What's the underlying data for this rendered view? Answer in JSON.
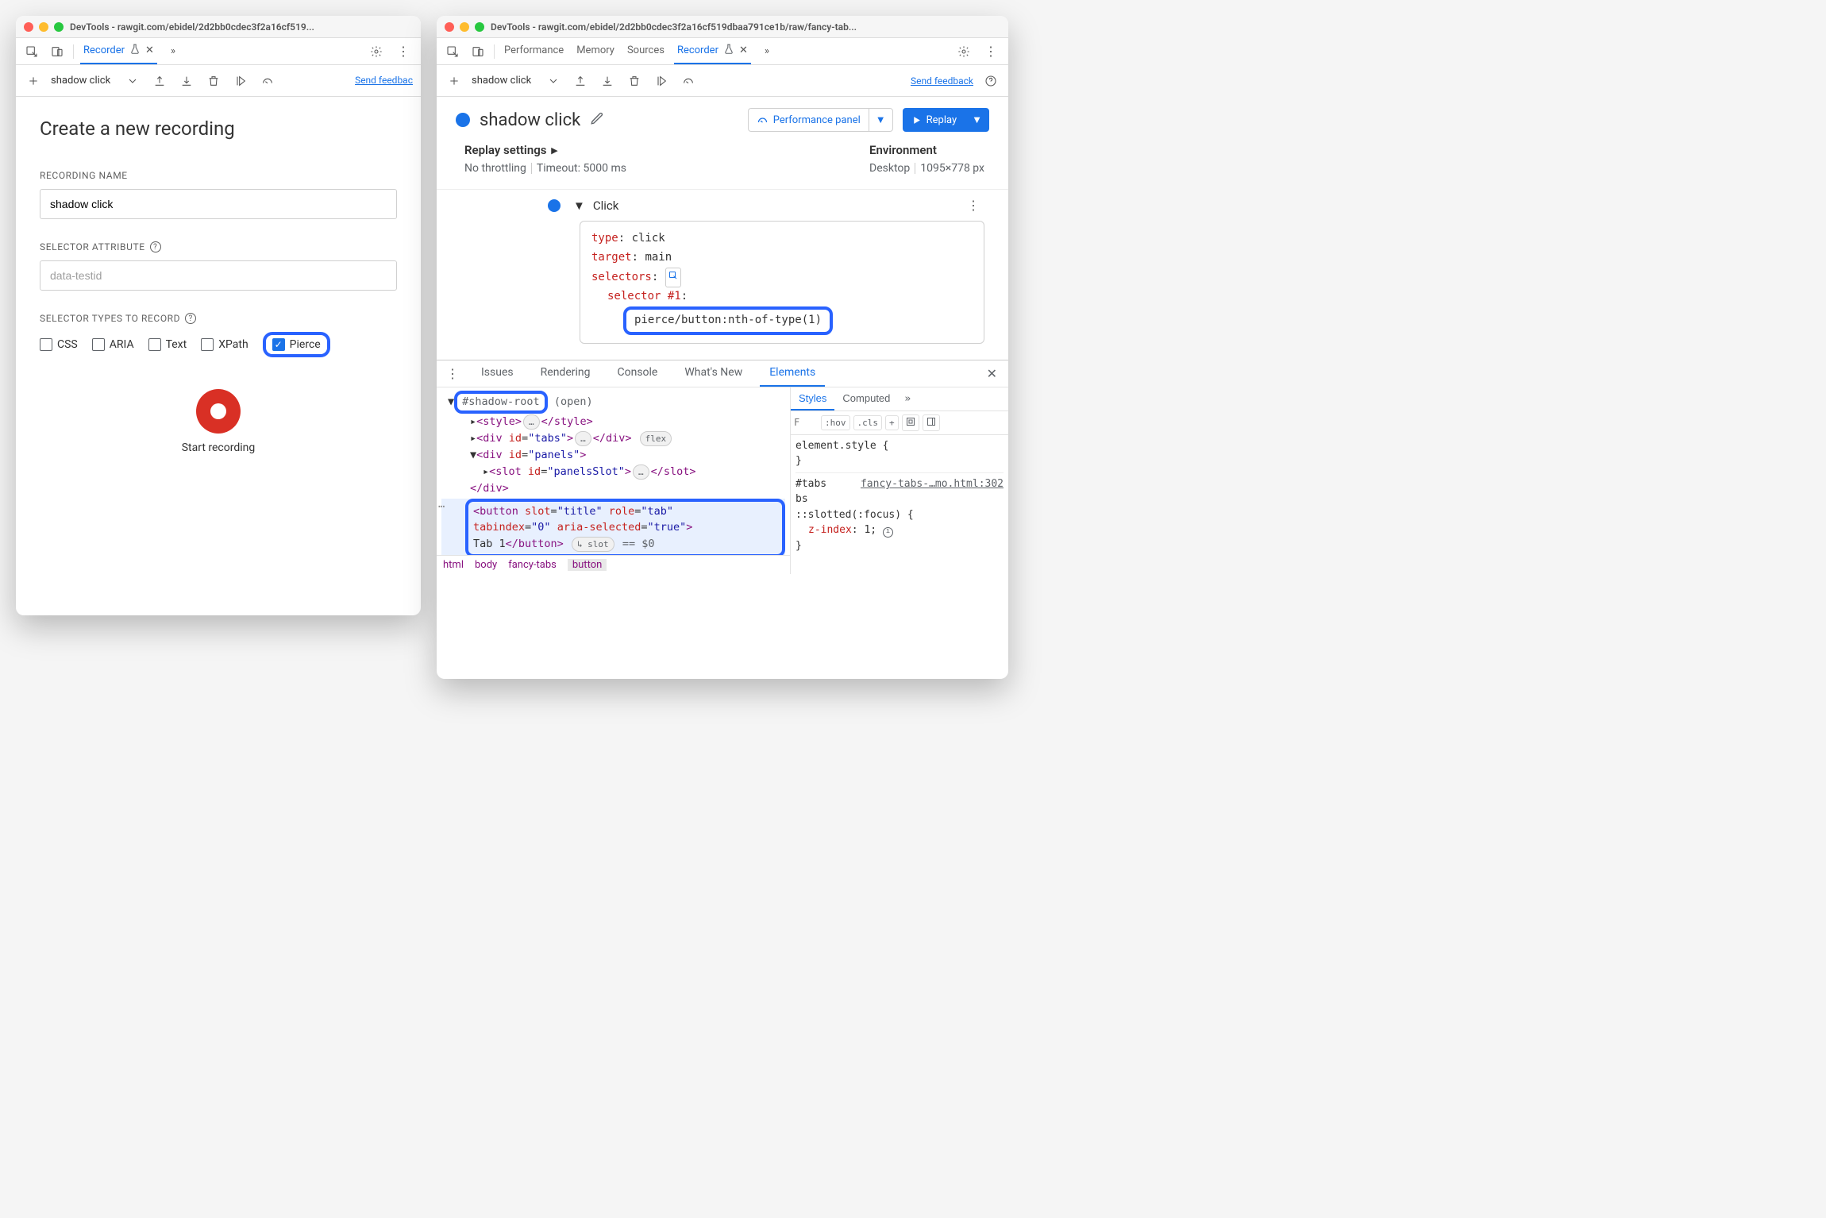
{
  "window_title": "DevTools - rawgit.com/ebidel/2d2bb0cdec3f2a16cf519...",
  "window_title2": "DevTools - rawgit.com/ebidel/2d2bb0cdec3f2a16cf519dbaa791ce1b/raw/fancy-tab...",
  "tabs": {
    "recorder": "Recorder",
    "performance": "Performance",
    "memory": "Memory",
    "sources": "Sources"
  },
  "subbar": {
    "name": "shadow click",
    "send_feedback": "Send feedback",
    "send_feedback_short": "Send feedbac"
  },
  "create": {
    "title": "Create a new recording",
    "name_label": "RECORDING NAME",
    "name_value": "shadow click",
    "selector_attr_label": "SELECTOR ATTRIBUTE",
    "selector_attr_placeholder": "data-testid",
    "selector_types_label": "SELECTOR TYPES TO RECORD",
    "types": {
      "css": "CSS",
      "aria": "ARIA",
      "text": "Text",
      "xpath": "XPath",
      "pierce": "Pierce"
    },
    "start_recording": "Start recording"
  },
  "flow": {
    "title": "shadow click",
    "perf_panel": "Performance panel",
    "replay": "Replay",
    "replay_settings": "Replay settings",
    "environment": "Environment",
    "throttling": "No throttling",
    "timeout": "Timeout: 5000 ms",
    "device": "Desktop",
    "viewport": "1095×778 px",
    "step_label": "Click",
    "step_type_key": "type",
    "step_type_val": "click",
    "step_target_key": "target",
    "step_target_val": "main",
    "step_selectors_key": "selectors",
    "step_sel1_key": "selector #1",
    "step_sel1_val": "pierce/button:nth-of-type(1)"
  },
  "drawer": {
    "issues": "Issues",
    "rendering": "Rendering",
    "console": "Console",
    "whatsnew": "What's New",
    "elements": "Elements",
    "tree": {
      "shadow_root": "#shadow-root",
      "open": "(open)",
      "style_open": "<style>",
      "style_close": "</style>",
      "div_tabs_open": "<div id=\"tabs\">",
      "div_tabs_close": "</div>",
      "flex_badge": "flex",
      "div_panels_open": "<div id=\"panels\">",
      "slot_open": "<slot id=\"panelsSlot\">",
      "slot_close": "</slot>",
      "div_close": "</div>",
      "button_line1": "<button slot=\"title\" role=\"tab\"",
      "button_line2": "tabindex=\"0\" aria-selected=\"true\">",
      "button_line3_text": "Tab 1",
      "button_line3_close": "</button>",
      "eq0": "== $0"
    },
    "crumbs": {
      "html": "html",
      "body": "body",
      "fancy": "fancy-tabs",
      "button": "button"
    },
    "styles": {
      "styles": "Styles",
      "computed": "Computed",
      "filter_placeholder": "F",
      "hov": ":hov",
      "cls": ".cls",
      "elstyle": "element.style {",
      "tabs_sel": "#tabs",
      "rule_src": "fancy-tabs-…mo.html:302",
      "slotted": "::slotted(:focus) {",
      "zindex_prop": "z-index",
      "zindex_val": "1"
    }
  }
}
